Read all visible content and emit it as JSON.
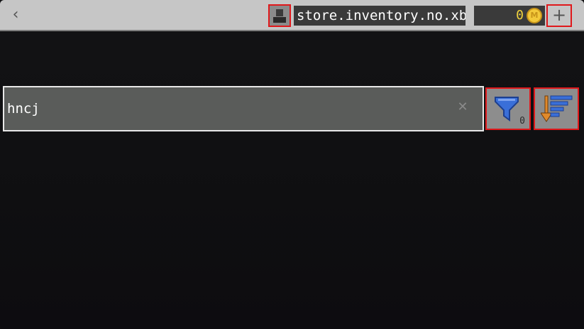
{
  "header": {
    "back_icon": "chevron-left-icon",
    "back_glyph": "‹",
    "avatar_icon": "profile-avatar-icon",
    "gamertag": "store.inventory.no.xbl",
    "coins": {
      "count": "0",
      "coin_icon": "minecoin-icon",
      "coin_glyph": "M"
    },
    "add_coins_glyph": "+"
  },
  "search": {
    "value": "hncj",
    "clear_glyph": "✕"
  },
  "filter": {
    "icon": "funnel-filter-icon",
    "count": "0",
    "color": "#3a6fd8"
  },
  "sort": {
    "icon": "sort-descending-icon",
    "arrow_color": "#e08a2c",
    "lines_color": "#3a6fd8"
  },
  "colors": {
    "highlight_border": "#e0181b",
    "coin_text": "#f2d33d"
  }
}
